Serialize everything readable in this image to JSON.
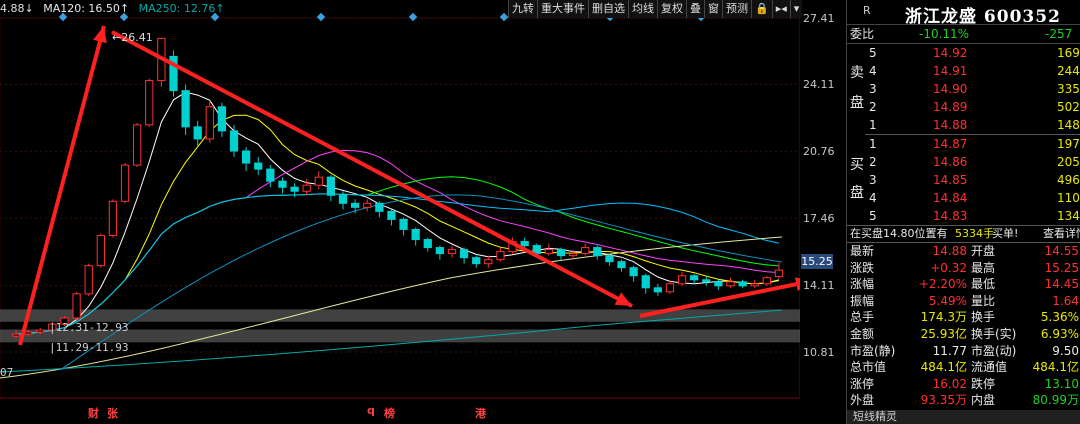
{
  "ma_legend": [
    {
      "label": "4.88↓",
      "color": "#e0e0e0"
    },
    {
      "label": "MA120: 16.50↑",
      "color": "#e8e8e8"
    },
    {
      "label": "MA250: 12.76↑",
      "color": "#00a8a8"
    }
  ],
  "toolbar": [
    "九转",
    "重大事件",
    "删自选",
    "均线",
    "复权",
    "叠",
    "窗",
    "预测",
    "🔒",
    "▸◂",
    "▾"
  ],
  "y_axis": [
    "27.41",
    "24.11",
    "20.76",
    "17.46",
    "15.25",
    "14.11",
    "10.81"
  ],
  "current_price_tag": "15.25",
  "high_marker": "26.41",
  "sr_bands": [
    "12.31-12.93",
    "11.29-11.93"
  ],
  "left_edge_label": "07",
  "events": [
    {
      "text": "财",
      "color": "#ff4040"
    },
    {
      "text": "张",
      "color": "#ff4040"
    },
    {
      "text": "q",
      "color": "#ff4040"
    },
    {
      "text": "榜",
      "color": "#ff4040"
    },
    {
      "text": "港",
      "color": "#ff4040"
    }
  ],
  "panel": {
    "r_label": "R",
    "name": "浙江龙盛",
    "code": "600352",
    "weibi_label": "委比",
    "weibi_value": "-10.11%",
    "weicha_value": "-257",
    "sell_side_label": [
      "卖",
      "盘"
    ],
    "buy_side_label": [
      "买",
      "盘"
    ],
    "asks": [
      {
        "level": "5",
        "price": "14.92",
        "vol": "169"
      },
      {
        "level": "4",
        "price": "14.91",
        "vol": "244"
      },
      {
        "level": "3",
        "price": "14.90",
        "vol": "335"
      },
      {
        "level": "2",
        "price": "14.89",
        "vol": "502"
      },
      {
        "level": "1",
        "price": "14.88",
        "vol": "148"
      }
    ],
    "bids": [
      {
        "level": "1",
        "price": "14.87",
        "vol": "197"
      },
      {
        "level": "2",
        "price": "14.86",
        "vol": "205"
      },
      {
        "level": "3",
        "price": "14.85",
        "vol": "496"
      },
      {
        "level": "4",
        "price": "14.84",
        "vol": "110"
      },
      {
        "level": "5",
        "price": "14.83",
        "vol": "134"
      }
    ],
    "info_bar": {
      "text1": "在买盘14.80位置有",
      "text2": "5334手",
      "text3": "买单!",
      "link": "查看详情"
    },
    "stats": [
      {
        "l1": "最新",
        "v1": "14.88",
        "c1": "red",
        "l2": "开盘",
        "v2": "14.55",
        "c2": "red"
      },
      {
        "l1": "涨跌",
        "v1": "+0.32",
        "c1": "red",
        "l2": "最高",
        "v2": "15.25",
        "c2": "red"
      },
      {
        "l1": "涨幅",
        "v1": "+2.20%",
        "c1": "red",
        "l2": "最低",
        "v2": "14.45",
        "c2": "red"
      },
      {
        "l1": "振幅",
        "v1": "5.49%",
        "c1": "red",
        "l2": "量比",
        "v2": "1.64",
        "c2": "red"
      },
      {
        "l1": "总手",
        "v1": "174.3万",
        "c1": "yellow",
        "l2": "换手",
        "v2": "5.36%",
        "c2": "yellow"
      },
      {
        "l1": "金额",
        "v1": "25.93亿",
        "c1": "yellow",
        "l2": "换手(实)",
        "v2": "6.93%",
        "c2": "yellow"
      },
      {
        "l1": "市盈(静)",
        "v1": "11.77",
        "c1": "white",
        "l2": "市盈(动)",
        "v2": "9.50",
        "c2": "white"
      },
      {
        "l1": "总市值",
        "v1": "484.1亿",
        "c1": "yellow",
        "l2": "流通值",
        "v2": "484.1亿",
        "c2": "yellow"
      },
      {
        "l1": "涨停",
        "v1": "16.02",
        "c1": "red",
        "l2": "跌停",
        "v2": "13.10",
        "c2": "green"
      },
      {
        "l1": "外盘",
        "v1": "93.35万",
        "c1": "red",
        "l2": "内盘",
        "v2": "80.99万",
        "c2": "green"
      }
    ],
    "short_bar": "短线精灵"
  },
  "colors": {
    "up": "#ff3030",
    "down": "#00d0d0",
    "arrow": "#ff2020",
    "ma5": "#ffffff",
    "ma10": "#ffff00",
    "ma20": "#ff40ff",
    "ma30": "#00ff00",
    "ma60": "#00c0ff",
    "ma120": "#e8e8a0",
    "ma250": "#00a8a8"
  },
  "chart_data": {
    "type": "candlestick",
    "y_ticks": [
      27.41,
      24.11,
      20.76,
      17.46,
      14.11,
      10.81
    ],
    "candles": [
      [
        11.6,
        11.7,
        11.9,
        11.5
      ],
      [
        11.7,
        11.8,
        11.9,
        11.6
      ],
      [
        11.8,
        11.9,
        12.0,
        11.7
      ],
      [
        11.9,
        12.2,
        12.3,
        11.8
      ],
      [
        12.2,
        12.5,
        12.6,
        12.1
      ],
      [
        12.5,
        13.7,
        13.8,
        12.4
      ],
      [
        13.7,
        15.1,
        15.2,
        13.6
      ],
      [
        15.1,
        16.6,
        16.7,
        15.0
      ],
      [
        16.6,
        18.3,
        18.4,
        16.5
      ],
      [
        18.3,
        20.1,
        20.2,
        18.2
      ],
      [
        20.1,
        22.1,
        22.2,
        20.0
      ],
      [
        22.1,
        24.3,
        24.4,
        22.0
      ],
      [
        24.3,
        26.4,
        26.41,
        24.0
      ],
      [
        25.5,
        23.8,
        25.8,
        23.5
      ],
      [
        23.8,
        22.0,
        24.1,
        21.6
      ],
      [
        22.0,
        21.4,
        22.3,
        21.0
      ],
      [
        21.4,
        23.0,
        23.3,
        21.2
      ],
      [
        23.0,
        21.8,
        23.2,
        21.5
      ],
      [
        21.8,
        20.8,
        22.1,
        20.5
      ],
      [
        20.8,
        20.2,
        21.0,
        19.8
      ],
      [
        20.2,
        19.9,
        20.5,
        19.6
      ],
      [
        19.9,
        19.3,
        20.1,
        19.0
      ],
      [
        19.3,
        19.0,
        19.5,
        18.7
      ],
      [
        19.0,
        18.8,
        19.2,
        18.5
      ],
      [
        18.8,
        19.1,
        19.4,
        18.6
      ],
      [
        19.1,
        19.5,
        19.8,
        18.9
      ],
      [
        19.5,
        18.6,
        19.6,
        18.3
      ],
      [
        18.6,
        18.2,
        18.8,
        17.9
      ],
      [
        18.2,
        18.0,
        18.4,
        17.7
      ],
      [
        18.0,
        18.2,
        18.4,
        17.8
      ],
      [
        18.2,
        17.8,
        18.3,
        17.5
      ],
      [
        17.8,
        17.4,
        17.9,
        17.1
      ],
      [
        17.4,
        16.9,
        17.5,
        16.6
      ],
      [
        16.9,
        16.4,
        17.0,
        16.1
      ],
      [
        16.4,
        16.0,
        16.5,
        15.8
      ],
      [
        16.0,
        15.7,
        16.1,
        15.4
      ],
      [
        15.7,
        15.9,
        16.1,
        15.5
      ],
      [
        15.9,
        15.5,
        16.0,
        15.2
      ],
      [
        15.5,
        15.2,
        15.6,
        15.0
      ],
      [
        15.2,
        15.4,
        15.6,
        15.0
      ],
      [
        15.4,
        15.8,
        16.0,
        15.3
      ],
      [
        15.8,
        16.3,
        16.5,
        15.7
      ],
      [
        16.3,
        16.1,
        16.5,
        15.8
      ],
      [
        16.1,
        15.7,
        16.2,
        15.5
      ],
      [
        15.7,
        15.9,
        16.2,
        15.6
      ],
      [
        15.9,
        15.6,
        16.0,
        15.4
      ],
      [
        15.6,
        15.7,
        15.9,
        15.4
      ],
      [
        15.7,
        16.0,
        16.2,
        15.6
      ],
      [
        16.0,
        15.6,
        16.1,
        15.4
      ],
      [
        15.6,
        15.3,
        15.7,
        15.1
      ],
      [
        15.3,
        15.0,
        15.4,
        14.8
      ],
      [
        15.0,
        14.6,
        15.1,
        14.3
      ],
      [
        14.6,
        14.0,
        14.7,
        13.7
      ],
      [
        14.0,
        13.8,
        14.2,
        13.6
      ],
      [
        13.8,
        14.2,
        14.4,
        13.7
      ],
      [
        14.2,
        14.6,
        14.8,
        14.1
      ],
      [
        14.6,
        14.4,
        14.7,
        14.2
      ],
      [
        14.4,
        14.3,
        14.6,
        14.1
      ],
      [
        14.3,
        14.1,
        14.4,
        13.9
      ],
      [
        14.1,
        14.3,
        14.5,
        14.0
      ],
      [
        14.3,
        14.1,
        14.4,
        14.0
      ],
      [
        14.1,
        14.2,
        14.4,
        14.0
      ],
      [
        14.2,
        14.5,
        14.6,
        14.1
      ],
      [
        14.56,
        14.88,
        15.25,
        14.45
      ]
    ]
  }
}
